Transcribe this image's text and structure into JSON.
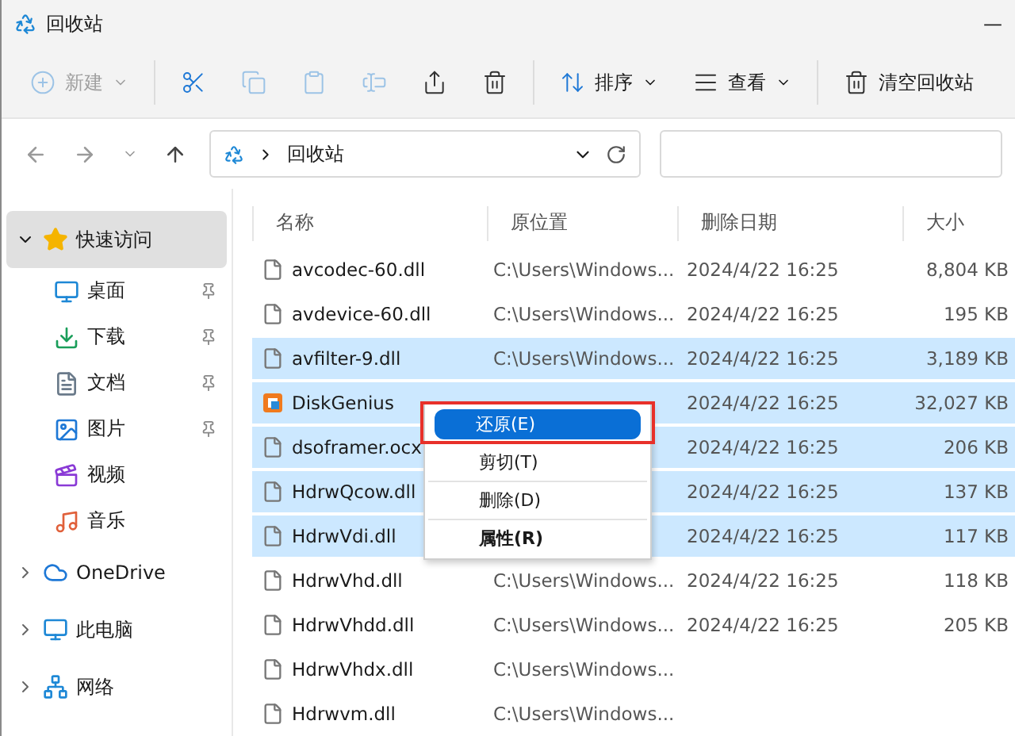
{
  "window": {
    "title": "回收站",
    "minimize": "—"
  },
  "toolbar": [
    {
      "kind": "new",
      "label": "新建",
      "disabled": true
    },
    {
      "kind": "cut",
      "disabled": false
    },
    {
      "kind": "copy",
      "disabled": true
    },
    {
      "kind": "paste",
      "disabled": true
    },
    {
      "kind": "rename",
      "disabled": true
    },
    {
      "kind": "share",
      "disabled": false
    },
    {
      "kind": "delete",
      "disabled": false
    },
    {
      "kind": "sort",
      "label": "排序",
      "disabled": false
    },
    {
      "kind": "view",
      "label": "查看",
      "disabled": false
    },
    {
      "kind": "empty",
      "label": "清空回收站",
      "disabled": false
    }
  ],
  "address": {
    "path": "回收站"
  },
  "sidebar": {
    "items": [
      {
        "label": "快速访问",
        "kind": "star",
        "selected": true,
        "expanded": true,
        "children": [
          {
            "label": "桌面",
            "kind": "desktop",
            "pinned": true
          },
          {
            "label": "下载",
            "kind": "download",
            "pinned": true
          },
          {
            "label": "文档",
            "kind": "docs",
            "pinned": true
          },
          {
            "label": "图片",
            "kind": "pictures",
            "pinned": true
          },
          {
            "label": "视频",
            "kind": "video",
            "pinned": false
          },
          {
            "label": "音乐",
            "kind": "music",
            "pinned": false
          }
        ]
      },
      {
        "label": "OneDrive",
        "kind": "cloud",
        "selected": false,
        "expanded": false
      },
      {
        "label": "此电脑",
        "kind": "pc",
        "selected": false,
        "expanded": false
      },
      {
        "label": "网络",
        "kind": "network",
        "selected": false,
        "expanded": false
      }
    ]
  },
  "table": {
    "columns": [
      "名称",
      "原位置",
      "删除日期",
      "大小"
    ],
    "rows": [
      {
        "name": "avcodec-60.dll",
        "kind": "dll",
        "location": "C:\\Users\\Windows...",
        "date": "2024/4/22 16:25",
        "size": "8,804 KB",
        "selected": false
      },
      {
        "name": "avdevice-60.dll",
        "kind": "dll",
        "location": "C:\\Users\\Windows...",
        "date": "2024/4/22 16:25",
        "size": "195 KB",
        "selected": false
      },
      {
        "name": "avfilter-9.dll",
        "kind": "dll",
        "location": "C:\\Users\\Windows...",
        "date": "2024/4/22 16:25",
        "size": "3,189 KB",
        "selected": true
      },
      {
        "name": "DiskGenius",
        "kind": "app",
        "date": "2024/4/22 16:25",
        "size": "32,027 KB",
        "selected": true
      },
      {
        "name": "dsoframer.ocx",
        "kind": "dll",
        "date": "2024/4/22 16:25",
        "size": "206 KB",
        "selected": true
      },
      {
        "name": "HdrwQcow.dll",
        "kind": "dll",
        "date": "2024/4/22 16:25",
        "size": "137 KB",
        "selected": true
      },
      {
        "name": "HdrwVdi.dll",
        "kind": "dll",
        "date": "2024/4/22 16:25",
        "size": "117 KB",
        "selected": true
      },
      {
        "name": "HdrwVhd.dll",
        "kind": "dll",
        "location": "C:\\Users\\Windows...",
        "date": "2024/4/22 16:25",
        "size": "118 KB",
        "selected": false
      },
      {
        "name": "HdrwVhdd.dll",
        "kind": "dll",
        "location": "C:\\Users\\Windows...",
        "date": "2024/4/22 16:25",
        "size": "205 KB",
        "selected": false
      },
      {
        "name": "HdrwVhdx.dll",
        "kind": "dll",
        "location": "C:\\Users\\Windows...",
        "selected": false
      },
      {
        "name": "Hdrwvm.dll",
        "kind": "dll",
        "location": "C:\\Users\\Windows...",
        "selected": false
      }
    ]
  },
  "context_menu": {
    "items": [
      {
        "label": "还原(E)",
        "selected": true,
        "bold": false
      },
      {
        "label": "剪切(T)",
        "selected": false,
        "bold": false
      },
      {
        "label": "删除(D)",
        "selected": false,
        "bold": false
      },
      {
        "label": "属性(R)",
        "selected": false,
        "bold": true
      }
    ]
  }
}
